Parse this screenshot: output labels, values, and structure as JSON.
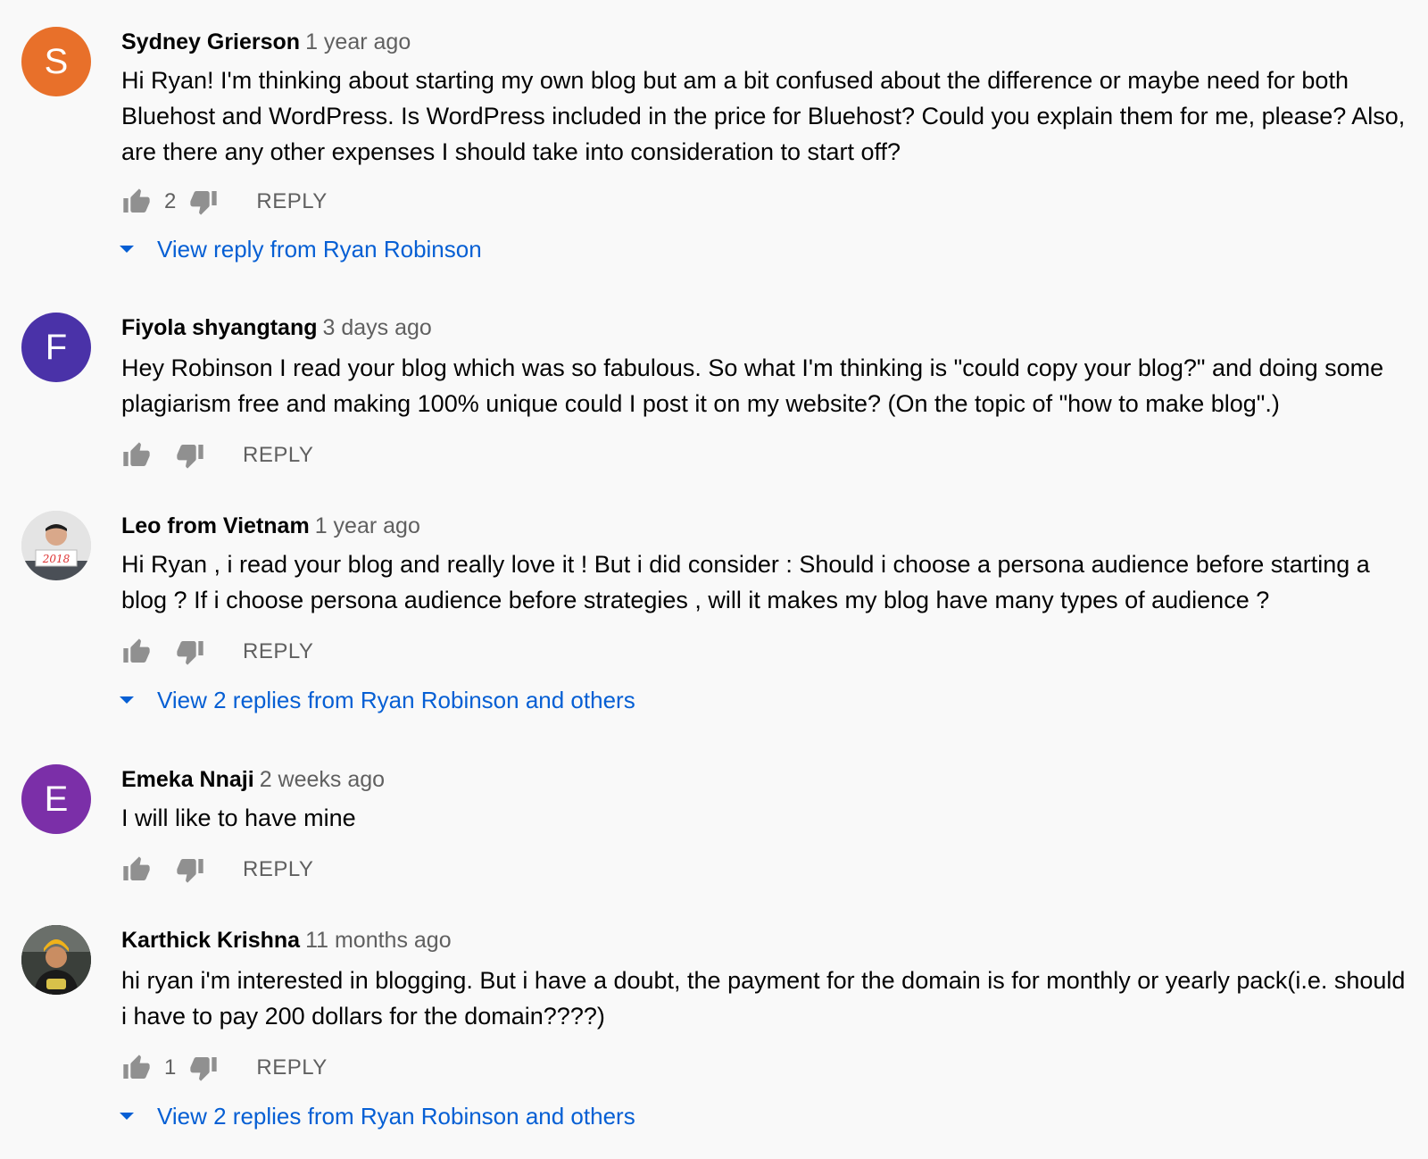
{
  "colors": {
    "background": "#f9f9f9",
    "link": "#065fd4",
    "secondary_text": "#606060"
  },
  "comments": [
    {
      "author": "Sydney Grierson",
      "time": "1 year ago",
      "avatar": {
        "type": "letter",
        "letter": "S",
        "color": "#e8702a"
      },
      "text": "Hi Ryan! I'm thinking about starting my own blog but am a bit confused about the difference or maybe need for both Bluehost and WordPress. Is WordPress included in the price for Bluehost? Could you explain them for me, please? Also, are there any other expenses I should take into consideration to start off?",
      "likes": "2",
      "reply_label": "REPLY",
      "view_replies": "View reply from Ryan Robinson"
    },
    {
      "author": "Fiyola shyangtang",
      "time": "3 days ago",
      "avatar": {
        "type": "letter",
        "letter": "F",
        "color": "#4a32a8"
      },
      "text": "Hey Robinson I read your blog which was so fabulous. So what I'm thinking is \"could copy your blog?\" and doing some plagiarism free and making 100% unique could I post it on my website? (On the topic of \"how to make blog\".)",
      "likes": "",
      "reply_label": "REPLY",
      "view_replies": ""
    },
    {
      "author": "Leo from Vietnam",
      "time": "1 year ago",
      "avatar": {
        "type": "photo",
        "letter": "",
        "color": "#d8d8d8"
      },
      "text": "Hi Ryan , i read your blog and really love it ! But i did consider : Should i choose a persona audience before starting a blog ? If i choose persona audience before strategies , will it makes my blog have many types of audience ?",
      "likes": "",
      "reply_label": "REPLY",
      "view_replies": "View 2 replies from Ryan Robinson and others"
    },
    {
      "author": "Emeka Nnaji",
      "time": "2 weeks ago",
      "avatar": {
        "type": "letter",
        "letter": "E",
        "color": "#7b2fa8"
      },
      "text": "I will like to have mine",
      "likes": "",
      "reply_label": "REPLY",
      "view_replies": ""
    },
    {
      "author": "Karthick Krishna",
      "time": "11 months ago",
      "avatar": {
        "type": "photo",
        "letter": "",
        "color": "#2a2a2a"
      },
      "text": "hi ryan i'm interested in blogging. But i have a doubt, the payment for the domain is for monthly or yearly pack(i.e. should i have to pay 200 dollars for the domain????)",
      "likes": "1",
      "reply_label": "REPLY",
      "view_replies": "View 2 replies from Ryan Robinson and others"
    }
  ]
}
